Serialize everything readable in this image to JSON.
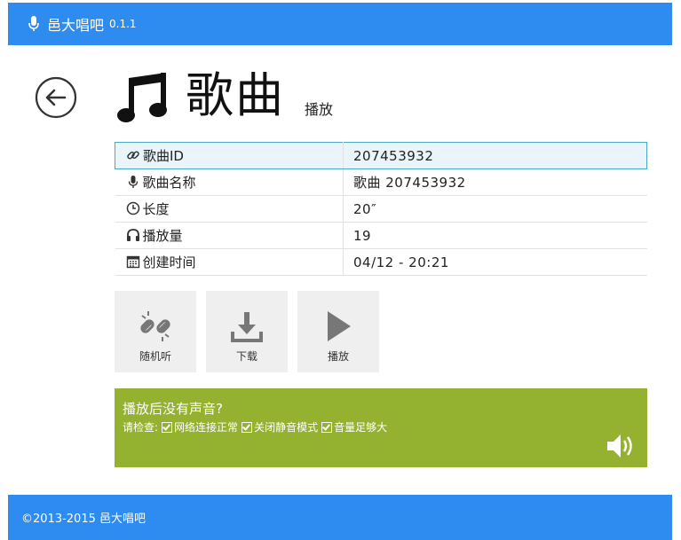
{
  "app": {
    "title": "邑大唱吧",
    "version": "0.1.1"
  },
  "page": {
    "title": "歌曲",
    "subtitle": "播放"
  },
  "info": [
    {
      "key": "歌曲ID",
      "value": "207453932",
      "icon": "link-icon"
    },
    {
      "key": "歌曲名称",
      "value": "歌曲 207453932",
      "icon": "mic-icon"
    },
    {
      "key": "长度",
      "value": "20″",
      "icon": "clock-icon"
    },
    {
      "key": "播放量",
      "value": "19",
      "icon": "headphones-icon"
    },
    {
      "key": "创建时间",
      "value": "04/12 - 20:21",
      "icon": "calendar-icon"
    }
  ],
  "actions": {
    "random": "随机听",
    "download": "下载",
    "play": "播放"
  },
  "notice": {
    "title": "播放后没有声音?",
    "check_label": "请检查:",
    "checks": [
      "网络连接正常",
      "关闭静音模式",
      "音量足够大"
    ]
  },
  "footer": {
    "text": "©2013-2015 邑大唱吧"
  },
  "colors": {
    "brand": "#2e8bf0",
    "notice": "#94b130",
    "highlight_row": "#e9f5fa"
  }
}
